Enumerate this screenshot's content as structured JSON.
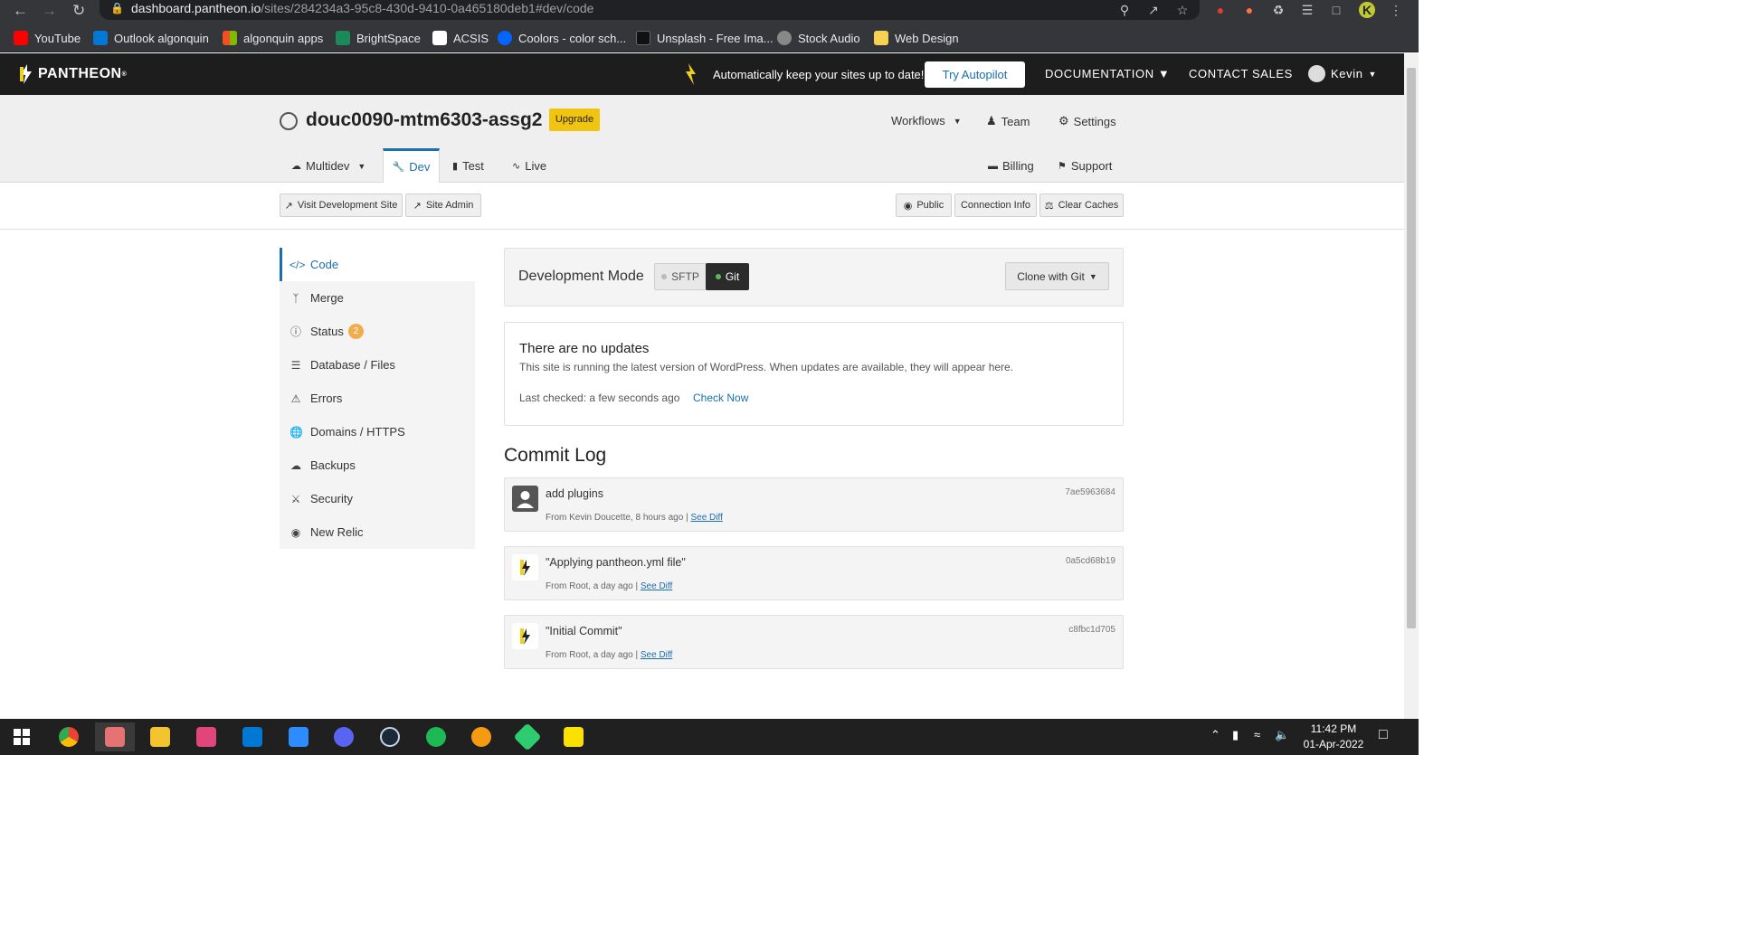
{
  "browser": {
    "url_host": "dashboard.pantheon.io",
    "url_path": "/sites/284234a3-95c8-430d-9410-0a465180deb1#dev/code",
    "bookmarks": [
      {
        "label": "YouTube",
        "color": "#ff0000"
      },
      {
        "label": "Outlook algonquin",
        "color": "#0078d4"
      },
      {
        "label": "algonquin apps",
        "color": "#f25022"
      },
      {
        "label": "BrightSpace",
        "color": "#1b8a5a"
      },
      {
        "label": "ACSIS",
        "color": "#ffffff"
      },
      {
        "label": "Coolors - color sch...",
        "color": "#0066ff"
      },
      {
        "label": "Unsplash - Free Ima...",
        "color": "#111111"
      },
      {
        "label": "Stock Audio",
        "color": "#888888"
      },
      {
        "label": "Web Design",
        "color": "#f7d154"
      }
    ],
    "avatar_letter": "K"
  },
  "header": {
    "brand": "PANTHEON",
    "banner": "Automatically keep your sites up to date!",
    "try_autopilot": "Try Autopilot",
    "documentation": "DOCUMENTATION",
    "contact_sales": "CONTACT SALES",
    "user": "Kevin"
  },
  "site": {
    "name": "douc0090-mtm6303-assg2",
    "upgrade": "Upgrade",
    "workflows": "Workflows",
    "team": "Team",
    "settings": "Settings",
    "billing": "Billing",
    "support": "Support",
    "tabs": {
      "multidev": "Multidev",
      "dev": "Dev",
      "test": "Test",
      "live": "Live"
    }
  },
  "actions": {
    "visit_site": "Visit Development Site",
    "site_admin": "Site Admin",
    "public": "Public",
    "connection_info": "Connection Info",
    "clear_caches": "Clear Caches"
  },
  "sidebar": {
    "items": [
      {
        "label": "Code",
        "icon": "code-icon"
      },
      {
        "label": "Merge",
        "icon": "merge-icon"
      },
      {
        "label": "Status",
        "icon": "info-icon",
        "badge": "2"
      },
      {
        "label": "Database / Files",
        "icon": "database-icon"
      },
      {
        "label": "Errors",
        "icon": "warning-icon"
      },
      {
        "label": "Domains / HTTPS",
        "icon": "globe-icon"
      },
      {
        "label": "Backups",
        "icon": "cloud-icon"
      },
      {
        "label": "Security",
        "icon": "security-icon"
      },
      {
        "label": "New Relic",
        "icon": "eye-icon"
      }
    ]
  },
  "dev_mode": {
    "label": "Development Mode",
    "sftp": "SFTP",
    "git": "Git",
    "clone": "Clone with Git"
  },
  "updates": {
    "title": "There are no updates",
    "description": "This site is running the latest version of WordPress. When updates are available, they will appear here.",
    "last_checked": "Last checked: a few seconds ago",
    "check_now": "Check Now"
  },
  "commit_log": {
    "title": "Commit Log",
    "commits": [
      {
        "message": "add plugins",
        "meta": "From Kevin Doucette, 8 hours ago |",
        "diff": "See Diff",
        "hash": "7ae5963684"
      },
      {
        "message": "\"Applying pantheon.yml file\"",
        "meta": "From Root, a day ago |",
        "diff": "See Diff",
        "hash": "0a5cd68b19"
      },
      {
        "message": "\"Initial Commit\"",
        "meta": "From Root, a day ago |",
        "diff": "See Diff",
        "hash": "c8fbc1d705"
      }
    ]
  },
  "taskbar": {
    "time": "11:42 PM",
    "date": "01-Apr-2022"
  }
}
